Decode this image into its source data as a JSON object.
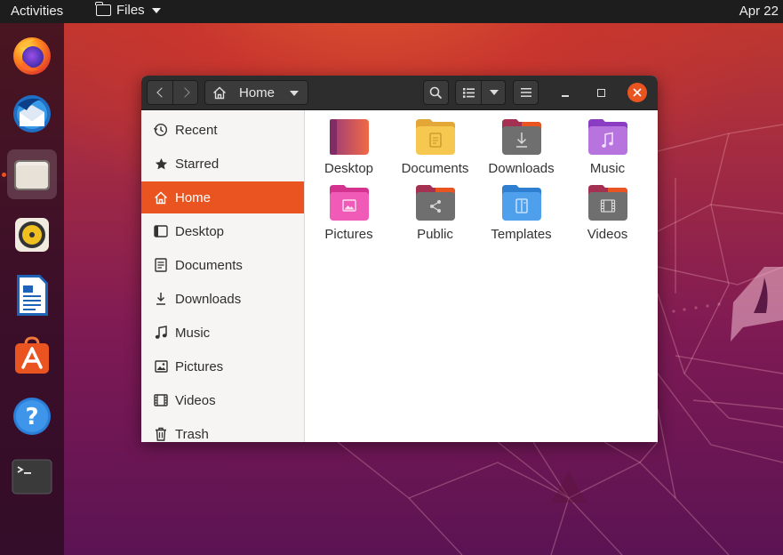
{
  "topbar": {
    "activities_label": "Activities",
    "app_name": "Files",
    "clock": "Apr 22"
  },
  "dock": {
    "items": [
      {
        "name": "firefox",
        "icon": "firefox-icon",
        "active": false
      },
      {
        "name": "thunderbird",
        "icon": "thunderbird-icon",
        "active": false
      },
      {
        "name": "files",
        "icon": "files-icon",
        "active": true
      },
      {
        "name": "rhythmbox",
        "icon": "rhythmbox-icon",
        "active": false
      },
      {
        "name": "libreoffice-writer",
        "icon": "writer-icon",
        "active": false
      },
      {
        "name": "ubuntu-software",
        "icon": "software-icon",
        "active": false
      },
      {
        "name": "help",
        "icon": "help-icon",
        "active": false
      },
      {
        "name": "terminal",
        "icon": "terminal-icon",
        "active": false
      }
    ]
  },
  "headerbar": {
    "path_label": "Home"
  },
  "sidebar": {
    "items": [
      {
        "label": "Recent",
        "icon": "clock-icon"
      },
      {
        "label": "Starred",
        "icon": "star-icon"
      },
      {
        "label": "Home",
        "icon": "home-icon",
        "active": true
      },
      {
        "label": "Desktop",
        "icon": "desktop-icon"
      },
      {
        "label": "Documents",
        "icon": "document-icon"
      },
      {
        "label": "Downloads",
        "icon": "download-icon"
      },
      {
        "label": "Music",
        "icon": "music-icon"
      },
      {
        "label": "Pictures",
        "icon": "picture-icon"
      },
      {
        "label": "Videos",
        "icon": "video-icon"
      },
      {
        "label": "Trash",
        "icon": "trash-icon"
      }
    ]
  },
  "files": {
    "items": [
      {
        "label": "Desktop",
        "icon": "desktop-folder-icon",
        "color": "#b84a6e"
      },
      {
        "label": "Documents",
        "icon": "documents-folder-icon",
        "color": "#f5c34e"
      },
      {
        "label": "Downloads",
        "icon": "downloads-folder-icon",
        "color": "#6b6b6b"
      },
      {
        "label": "Music",
        "icon": "music-folder-icon",
        "color": "#b26bd8"
      },
      {
        "label": "Pictures",
        "icon": "pictures-folder-icon",
        "color": "#ee56b1"
      },
      {
        "label": "Public",
        "icon": "public-folder-icon",
        "color": "#6b6b6b"
      },
      {
        "label": "Templates",
        "icon": "templates-folder-icon",
        "color": "#4c9be8"
      },
      {
        "label": "Videos",
        "icon": "videos-folder-icon",
        "color": "#6b6b6b"
      }
    ]
  },
  "colors": {
    "accent": "#e95420",
    "topbar": "#1d1d1d",
    "headerbar": "#2d2d2d"
  }
}
